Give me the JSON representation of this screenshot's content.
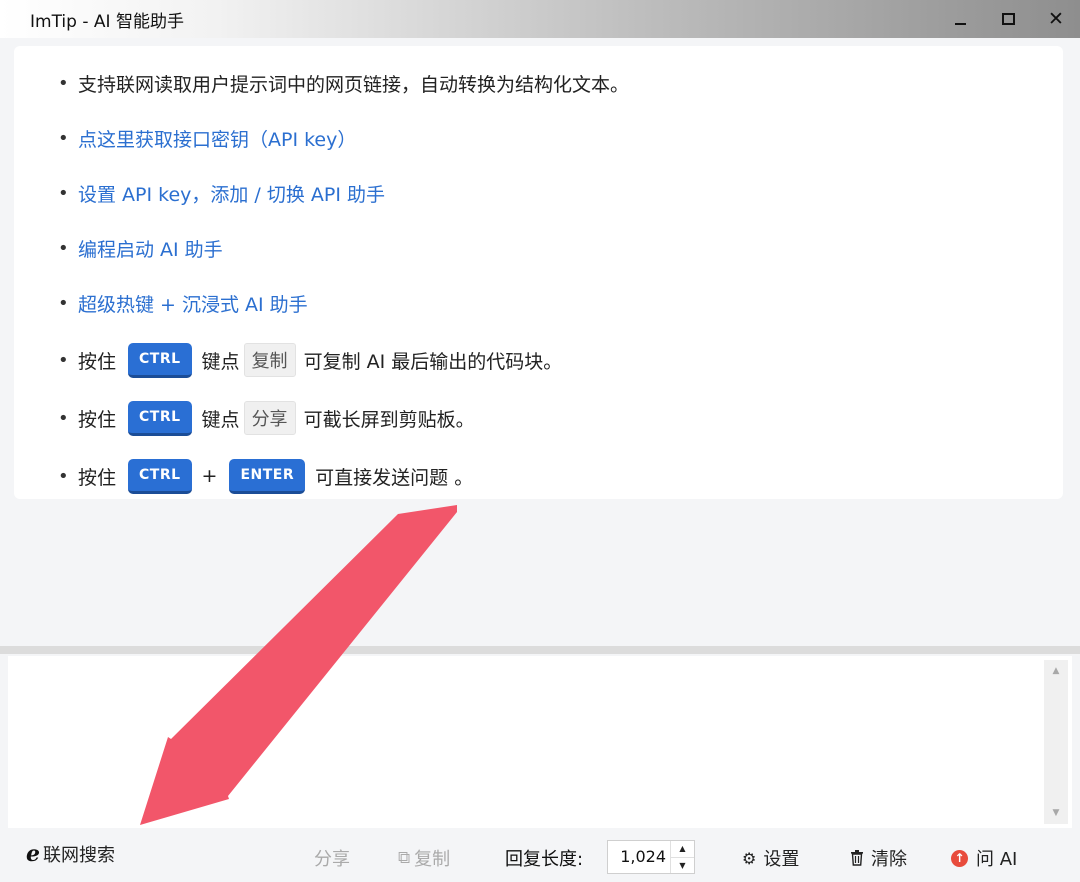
{
  "window": {
    "title": "ImTip - AI 智能助手",
    "controls": {
      "minimize": "minimize",
      "maximize": "maximize",
      "close": "✕"
    }
  },
  "tips": {
    "item1": "支持联网读取用户提示词中的网页链接，自动转换为结构化文本。",
    "item2": "点这里获取接口密钥（API key）",
    "item3": "设置 API key，添加 / 切换 API 助手",
    "item4": "编程启动 AI 助手",
    "item5": "超级热键 + 沉浸式 AI 助手",
    "key_row1": {
      "prefix": "按住",
      "key": "CTRL",
      "mid": "键点",
      "chip": "复制",
      "suffix": "可复制 AI 最后输出的代码块。"
    },
    "key_row2": {
      "prefix": "按住",
      "key": "CTRL",
      "mid": "键点",
      "chip": "分享",
      "suffix": "可截长屏到剪贴板。"
    },
    "key_row3": {
      "prefix": "按住",
      "key1": "CTRL",
      "plus": "+",
      "key2": "ENTER",
      "suffix": "可直接发送问题 。"
    }
  },
  "input": {
    "value": ""
  },
  "bottombar": {
    "web_search": "联网搜索",
    "share": "分享",
    "copy": "复制",
    "reply_length_label": "回复长度:",
    "reply_length_value": "1,024",
    "settings": "设置",
    "clear": "清除",
    "ask": "问 AI"
  },
  "icons": {
    "web_search": "ie-icon",
    "copy": "copy-icon",
    "settings": "gear-icon",
    "clear": "trash-icon",
    "ask": "up-arrow-circle-icon"
  },
  "colors": {
    "link": "#2b6fd0",
    "key_bg": "#2a6fd4",
    "arrow": "#f2566a",
    "ask_icon": "#e84b3c"
  }
}
